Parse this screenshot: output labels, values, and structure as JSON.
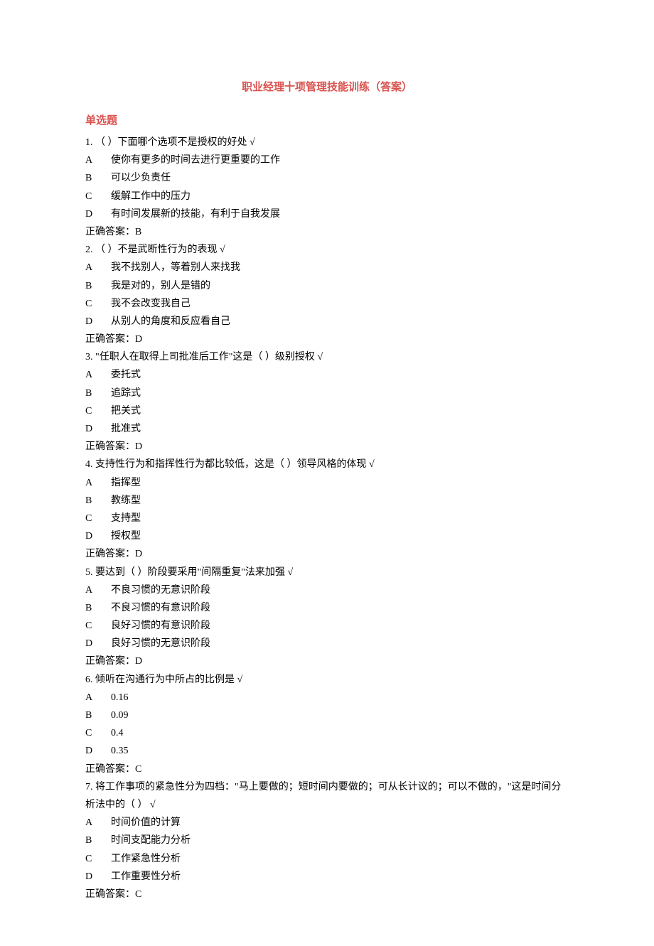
{
  "title": "职业经理十项管理技能训练（答案）",
  "section": "单选题",
  "checkmark": "√",
  "answer_prefix": "正确答案：  ",
  "questions": [
    {
      "num": "1.",
      "text": "（ ）下面哪个选项不是授权的好处",
      "options": [
        {
          "label": "A",
          "text": "使你有更多的时间去进行更重要的工作"
        },
        {
          "label": "B",
          "text": "可以少负责任"
        },
        {
          "label": "C",
          "text": "缓解工作中的压力"
        },
        {
          "label": "D",
          "text": "有时间发展新的技能，有利于自我发展"
        }
      ],
      "answer": "B"
    },
    {
      "num": "2.",
      "text": "（ ）不是武断性行为的表现",
      "options": [
        {
          "label": "A",
          "text": "我不找别人，等着别人来找我"
        },
        {
          "label": "B",
          "text": "我是对的，别人是错的"
        },
        {
          "label": "C",
          "text": "我不会改变我自己"
        },
        {
          "label": "D",
          "text": "从别人的角度和反应看自己"
        }
      ],
      "answer": "D"
    },
    {
      "num": "3.",
      "text": "\"任职人在取得上司批准后工作\"这是（ ）级别授权",
      "options": [
        {
          "label": "A",
          "text": "委托式"
        },
        {
          "label": "B",
          "text": "追踪式"
        },
        {
          "label": "C",
          "text": "把关式"
        },
        {
          "label": "D",
          "text": "批准式"
        }
      ],
      "answer": "D"
    },
    {
      "num": "4.",
      "text": "支持性行为和指挥性行为都比较低，这是（ ）领导风格的体现",
      "options": [
        {
          "label": "A",
          "text": "指挥型"
        },
        {
          "label": "B",
          "text": "教练型"
        },
        {
          "label": "C",
          "text": "支持型"
        },
        {
          "label": "D",
          "text": "授权型"
        }
      ],
      "answer": "D"
    },
    {
      "num": "5.",
      "text": "要达到（ ）阶段要采用\"间隔重复\"法来加强",
      "options": [
        {
          "label": "A",
          "text": "不良习惯的无意识阶段"
        },
        {
          "label": "B",
          "text": "不良习惯的有意识阶段"
        },
        {
          "label": "C",
          "text": "良好习惯的有意识阶段"
        },
        {
          "label": "D",
          "text": "良好习惯的无意识阶段"
        }
      ],
      "answer": "D"
    },
    {
      "num": "6.",
      "text": "倾听在沟通行为中所占的比例是",
      "options": [
        {
          "label": "A",
          "text": "0.16"
        },
        {
          "label": "B",
          "text": "0.09"
        },
        {
          "label": "C",
          "text": "0.4"
        },
        {
          "label": "D",
          "text": "0.35"
        }
      ],
      "answer": "C"
    },
    {
      "num": "7.",
      "text": "将工作事项的紧急性分为四档：\"马上要做的；短时间内要做的；可从长计议的；可以不做的，\"这是时间分析法中的（ ）",
      "options": [
        {
          "label": "A",
          "text": "时间价值的计算"
        },
        {
          "label": "B",
          "text": "时间支配能力分析"
        },
        {
          "label": "C",
          "text": "工作紧急性分析"
        },
        {
          "label": "D",
          "text": "工作重要性分析"
        }
      ],
      "answer": "C"
    }
  ]
}
